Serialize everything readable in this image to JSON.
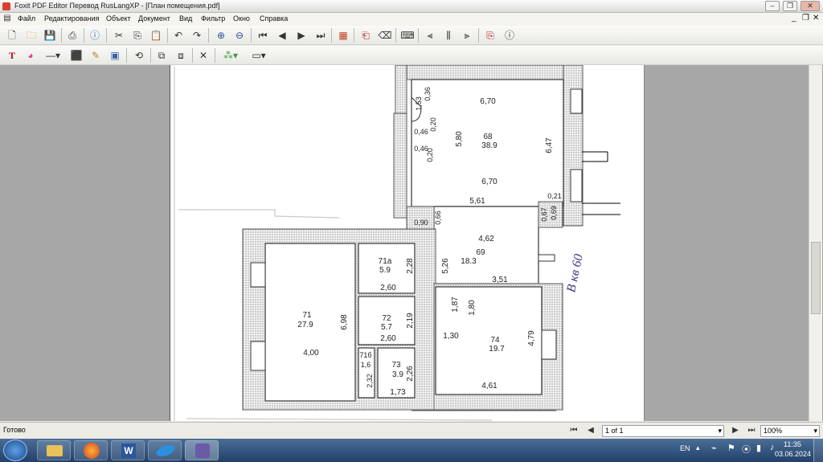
{
  "window": {
    "title": "Foxit PDF Editor Перевод RusLangXP - [План помещения.pdf]"
  },
  "menu": {
    "items": [
      "Файл",
      "Редактирования",
      "Объект",
      "Документ",
      "Вид",
      "Фильтр",
      "Окно",
      "Справка"
    ]
  },
  "floorplan": {
    "room_68": {
      "number": "68",
      "area": "38.9"
    },
    "room_69": {
      "number": "69",
      "area": "18.3"
    },
    "room_71": {
      "number": "71",
      "area": "27.9"
    },
    "room_71a": {
      "number": "71а",
      "area": "5.9"
    },
    "room_71b": {
      "number": "71б"
    },
    "room_72": {
      "number": "72",
      "area": "5.7"
    },
    "room_73": {
      "number": "73",
      "area": "3.9"
    },
    "room_74": {
      "number": "74",
      "area": "19.7"
    },
    "dims": {
      "d_670_top": "6,70",
      "d_670_bottom": "6,70",
      "d_580": "5,80",
      "d_647": "6,47",
      "d_561": "5,61",
      "d_036": "0,36",
      "d_153": "1,53",
      "d_046a": "0,46",
      "d_020a": "0,20",
      "d_046b": "0,46",
      "d_020b": "0,20",
      "d_090": "0,90",
      "d_066": "0,66",
      "d_021": "0,21",
      "d_069": "0,69",
      "d_067": "0,67",
      "d_462": "4,62",
      "d_526": "5,26",
      "d_351": "3,51",
      "d_187": "1,87",
      "d_180": "1,80",
      "d_130": "1,30",
      "d_479": "4,79",
      "d_461": "4,61",
      "d_698": "6,98",
      "d_400": "4,00",
      "d_228": "2,28",
      "d_260a": "2,60",
      "d_219": "2,19",
      "d_260b": "2,60",
      "d_16": "1,6",
      "d_232": "2,32",
      "d_226": "2,26",
      "d_173": "1,73"
    },
    "handwritten_note": "В кв 60"
  },
  "status": {
    "text": "Готово",
    "page_indicator": "1 of 1",
    "zoom": "100%"
  },
  "taskbar": {
    "language": "EN",
    "time": "11:35",
    "date": "03.06.2024"
  }
}
